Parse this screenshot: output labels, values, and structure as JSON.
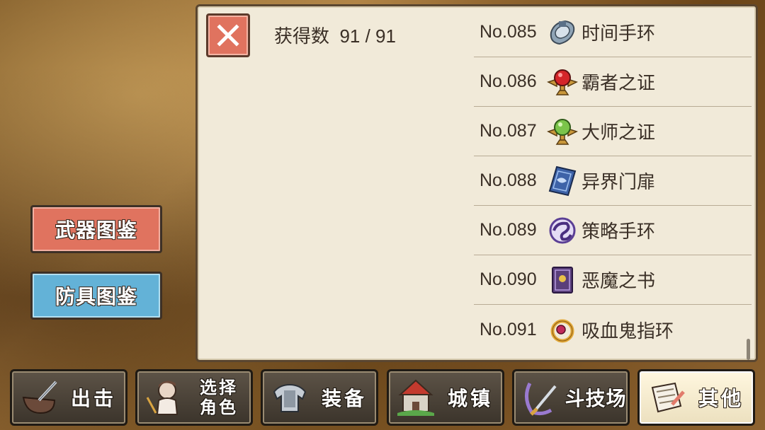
{
  "header": {
    "count_label": "获得数  91 / 91"
  },
  "sidebar": {
    "weapon_book": "武器图鉴",
    "armor_book": "防具图鉴"
  },
  "items": [
    {
      "no": "No.085",
      "name": "时间手环",
      "icon": "bracelet-icon"
    },
    {
      "no": "No.086",
      "name": "霸者之证",
      "icon": "red-emblem-icon"
    },
    {
      "no": "No.087",
      "name": "大师之证",
      "icon": "green-emblem-icon"
    },
    {
      "no": "No.088",
      "name": "异界门扉",
      "icon": "portal-card-icon"
    },
    {
      "no": "No.089",
      "name": "策略手环",
      "icon": "swirl-bracelet-icon"
    },
    {
      "no": "No.090",
      "name": "恶魔之书",
      "icon": "demon-book-icon"
    },
    {
      "no": "No.091",
      "name": "吸血鬼指环",
      "icon": "vampire-ring-icon"
    }
  ],
  "nav": [
    {
      "label": "出击",
      "icon": "sortie-icon"
    },
    {
      "label": "选择",
      "label2": "角色",
      "icon": "character-icon"
    },
    {
      "label": "装备",
      "icon": "armor-icon"
    },
    {
      "label": "城镇",
      "icon": "castle-icon"
    },
    {
      "label": "斗技场",
      "icon": "arena-icon"
    },
    {
      "label": "其他",
      "icon": "scroll-icon",
      "active": true
    }
  ]
}
